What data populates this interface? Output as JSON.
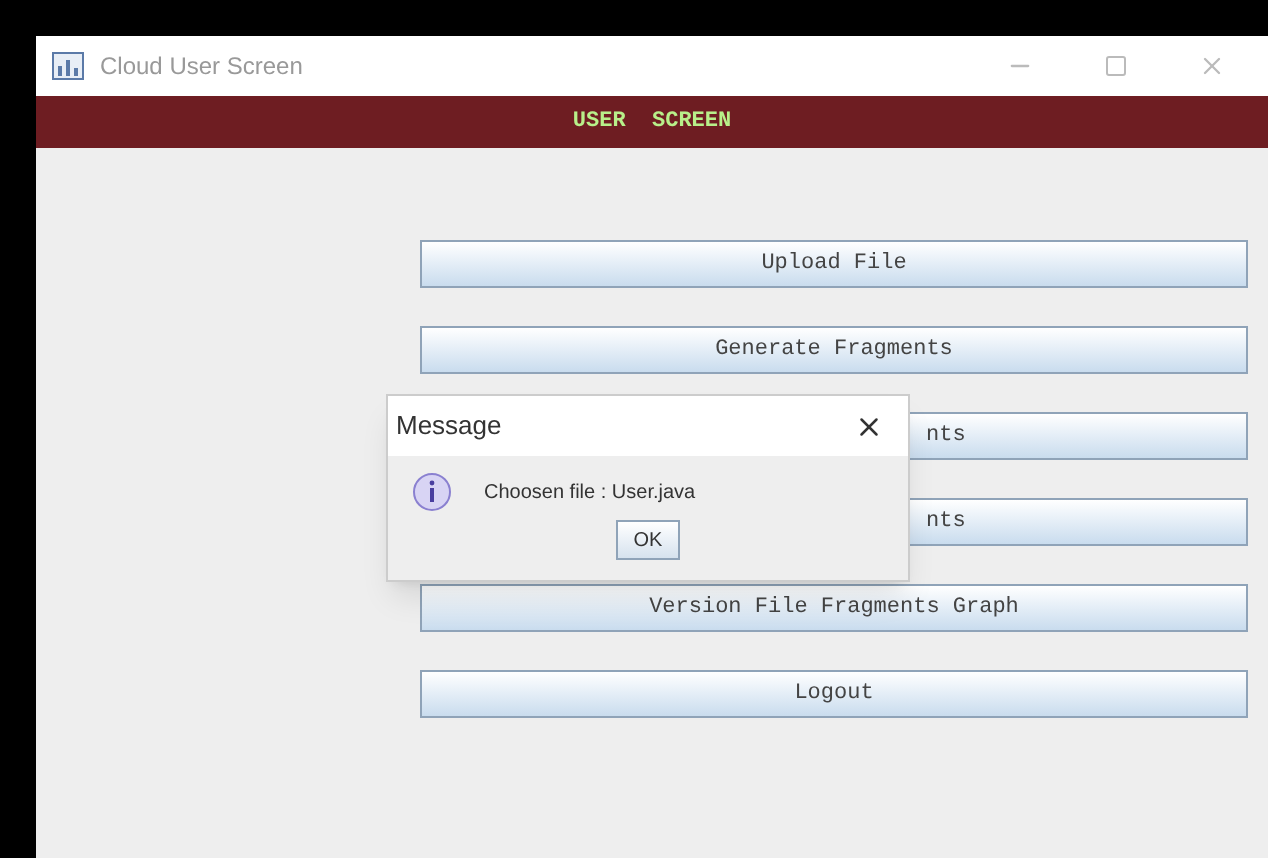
{
  "window": {
    "title": "Cloud User Screen"
  },
  "header": "USER  SCREEN",
  "buttons": [
    {
      "label": "Upload File",
      "kind": "full"
    },
    {
      "label": "Generate Fragments",
      "kind": "full"
    },
    {
      "label": "nts",
      "kind": "partial"
    },
    {
      "label": "nts",
      "kind": "partial"
    },
    {
      "label": "Version File Fragments Graph",
      "kind": "full"
    },
    {
      "label": "Logout",
      "kind": "full"
    }
  ],
  "dialog": {
    "title": "Message",
    "message": "Choosen file : User.java",
    "button": "OK"
  }
}
